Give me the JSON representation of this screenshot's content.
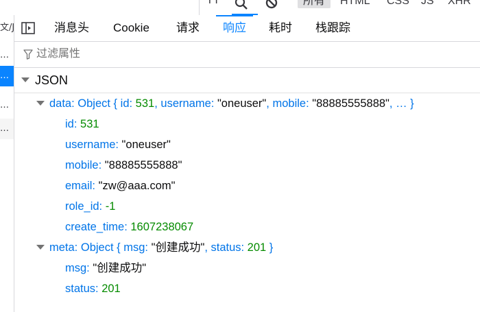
{
  "top_filters": {
    "font_toggle": "TT",
    "buttons": [
      "所有",
      "HTML",
      "CSS",
      "JS",
      "XHR"
    ],
    "selected": "所有"
  },
  "left_list": [
    "文/J",
    "…",
    "…",
    "…",
    "…"
  ],
  "tabs": [
    "消息头",
    "Cookie",
    "请求",
    "响应",
    "耗时",
    "栈跟踪"
  ],
  "active_tab": "响应",
  "filter": {
    "placeholder": "过滤属性"
  },
  "section": {
    "label": "JSON"
  },
  "tree": {
    "data_key": "data:",
    "data_summary": [
      {
        "t": "p",
        "v": " Object { "
      },
      {
        "t": "k",
        "v": "id:"
      },
      {
        "t": "n",
        "v": " 531"
      },
      {
        "t": "p",
        "v": ", "
      },
      {
        "t": "k",
        "v": "username:"
      },
      {
        "t": "s",
        "v": " \"oneuser\""
      },
      {
        "t": "p",
        "v": ", "
      },
      {
        "t": "k",
        "v": "mobile:"
      },
      {
        "t": "s",
        "v": " \"88885555888\""
      },
      {
        "t": "p",
        "v": ", … }"
      }
    ],
    "data_fields": [
      {
        "key": "id:",
        "value": " 531",
        "type": "n"
      },
      {
        "key": "username:",
        "value": " \"oneuser\"",
        "type": "s"
      },
      {
        "key": "mobile:",
        "value": " \"88885555888\"",
        "type": "s"
      },
      {
        "key": "email:",
        "value": " \"zw@aaa.com\"",
        "type": "s"
      },
      {
        "key": "role_id:",
        "value": " -1",
        "type": "n"
      },
      {
        "key": "create_time:",
        "value": " 1607238067",
        "type": "n"
      }
    ],
    "meta_key": "meta:",
    "meta_summary": [
      {
        "t": "p",
        "v": " Object { "
      },
      {
        "t": "k",
        "v": "msg:"
      },
      {
        "t": "s",
        "v": " \"创建成功\""
      },
      {
        "t": "p",
        "v": ", "
      },
      {
        "t": "k",
        "v": "status:"
      },
      {
        "t": "n",
        "v": " 201"
      },
      {
        "t": "p",
        "v": " }"
      }
    ],
    "meta_fields": [
      {
        "key": "msg:",
        "value": " \"创建成功\"",
        "type": "s"
      },
      {
        "key": "status:",
        "value": " 201",
        "type": "n"
      }
    ]
  },
  "colors": {
    "accent": "#0a84ff",
    "key": "#0074e8",
    "number": "#058b00",
    "string": "#0c0c0d"
  }
}
